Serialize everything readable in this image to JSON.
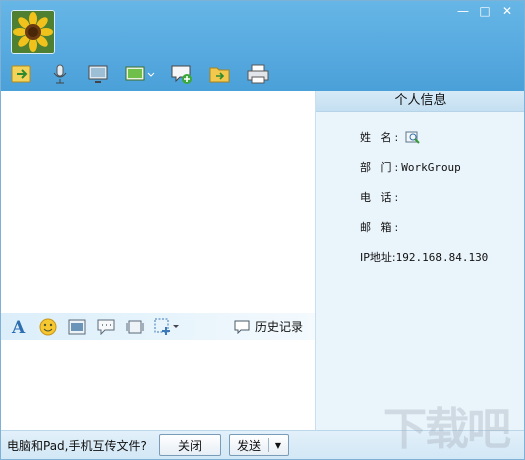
{
  "window": {
    "controls": {
      "minimize": "—",
      "maximize": "□",
      "close": "✕"
    }
  },
  "header": {
    "avatar_icon": "sunflower-avatar",
    "toolbar_icons": [
      "send-file-icon",
      "voice-icon",
      "monitor-icon",
      "remote-desktop-icon",
      "chat-add-icon",
      "shared-folder-icon",
      "printer-icon"
    ]
  },
  "input_toolbar": {
    "icons": [
      "font-icon",
      "emoji-icon",
      "screenshot-icon",
      "message-icon",
      "video-icon",
      "select-add-icon"
    ],
    "history_label": "历史记录"
  },
  "info": {
    "title": "个人信息",
    "name_label": "姓 名:",
    "dept_label": "部 门:",
    "dept_value": "WorkGroup",
    "phone_label": "电 话:",
    "email_label": "邮 箱:",
    "ip_label": "IP地址:",
    "ip_value": "192.168.84.130"
  },
  "bottom": {
    "prompt": "电脑和Pad,手机互传文件?",
    "close_label": "关闭",
    "send_label": "发送"
  },
  "watermark": "下载吧",
  "colors": {
    "header": "#56a9df",
    "panel": "#eaf4fb",
    "bar": "#dbeefa"
  }
}
